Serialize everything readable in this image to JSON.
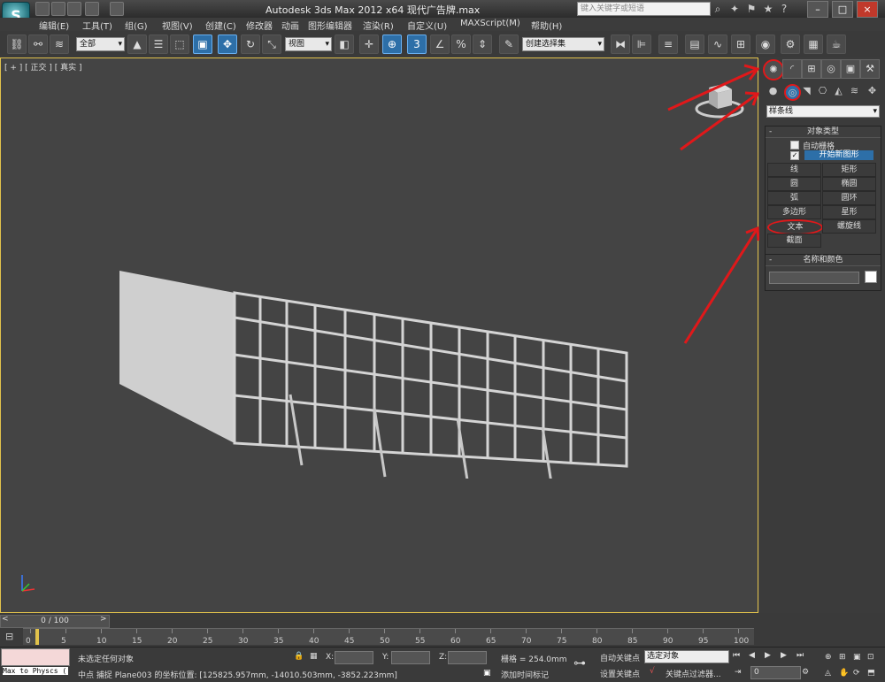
{
  "title": "Autodesk 3ds Max  2012 x64     现代广告牌.max",
  "search_placeholder": "键入关键字或短语",
  "menu": [
    "编辑(E)",
    "工具(T)",
    "组(G)",
    "视图(V)",
    "创建(C)",
    "修改器",
    "动画",
    "图形编辑器",
    "渲染(R)",
    "自定义(U)",
    "MAXScript(M)",
    "帮助(H)"
  ],
  "toolbar": {
    "selection_filter": "全部",
    "ref_coord": "视图",
    "named_selection": "创建选择集"
  },
  "viewport": {
    "label": "[ + ] [ 正交 ] [ 真实 ]"
  },
  "command_panel": {
    "category": "样条线",
    "object_type_title": "对象类型",
    "auto_grid": "自动栅格",
    "start_new_shape": "开始新图形",
    "buttons": [
      "线",
      "矩形",
      "圆",
      "椭圆",
      "弧",
      "圆环",
      "多边形",
      "星形",
      "文本",
      "螺旋线",
      "截面"
    ],
    "name_color_title": "名称和颜色"
  },
  "timeline": {
    "slider": "0 / 100",
    "ticks": [
      "0",
      "5",
      "10",
      "15",
      "20",
      "25",
      "30",
      "35",
      "40",
      "45",
      "50",
      "55",
      "60",
      "65",
      "70",
      "75",
      "80",
      "85",
      "90",
      "95",
      "100"
    ]
  },
  "status": {
    "script_listener": "Max to Physcs (",
    "selection": "未选定任何对象",
    "prompt": "中点 捕捉 Plane003 的坐标位置: [125825.957mm, -14010.503mm, -3852.223mm]",
    "x_label": "X:",
    "y_label": "Y:",
    "z_label": "Z:",
    "grid": "栅格 = 254.0mm",
    "add_time_tag": "添加时间标记",
    "auto_key": "自动关键点",
    "selected_label": "选定对象",
    "set_key": "设置关键点",
    "key_filters": "关键点过滤器...",
    "frame_value": "0"
  },
  "colors": {
    "highlight": "#e1c24b",
    "annotation": "#e0181a",
    "active_button": "#2d6fa8"
  }
}
